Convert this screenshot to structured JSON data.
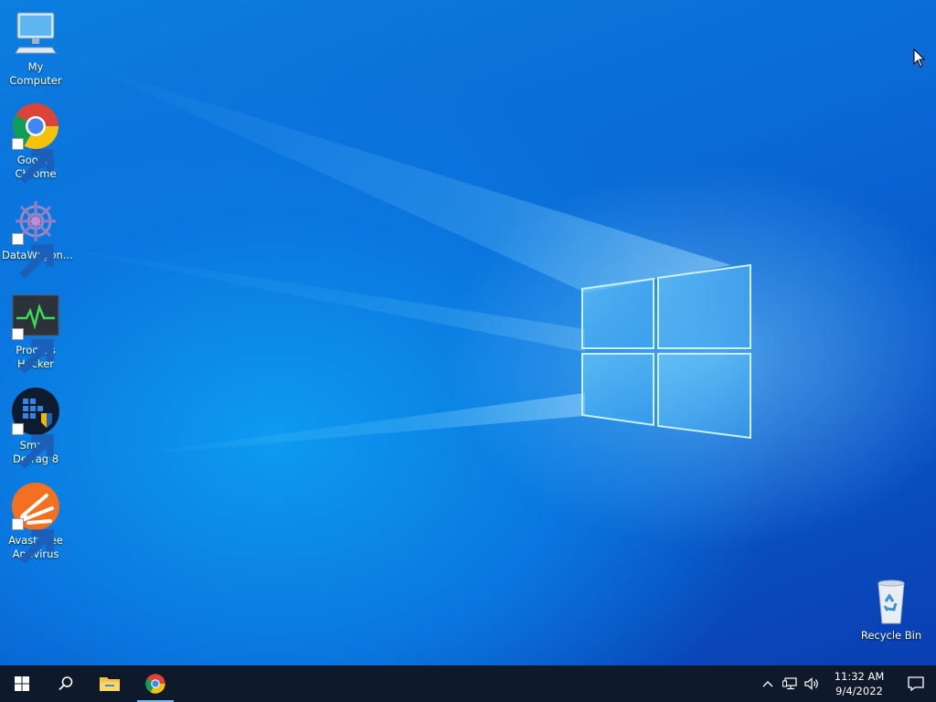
{
  "desktop": {
    "icons": [
      {
        "label": "My Computer",
        "icon": "computer-icon",
        "shortcut": false
      },
      {
        "label": "Google Chrome",
        "icon": "chrome-icon",
        "shortcut": true
      },
      {
        "label": "DataWagon...",
        "icon": "datawagon-icon",
        "shortcut": true
      },
      {
        "label": "Process Hacker",
        "icon": "process-hacker-icon",
        "shortcut": true
      },
      {
        "label": "Smart Defrag 8",
        "icon": "smart-defrag-icon",
        "shortcut": true
      },
      {
        "label": "Avast Free Antivirus",
        "icon": "avast-icon",
        "shortcut": true
      }
    ],
    "recycle_bin": {
      "label": "Recycle Bin",
      "icon": "recycle-bin-icon"
    }
  },
  "taskbar": {
    "start": {
      "icon": "windows-start-icon"
    },
    "search": {
      "icon": "search-icon"
    },
    "pinned": [
      {
        "name": "File Explorer",
        "icon": "folder-icon",
        "active": false
      },
      {
        "name": "Google Chrome",
        "icon": "chrome-icon",
        "active": true
      }
    ],
    "tray": {
      "icons": [
        "chevron-up-icon",
        "network-icon",
        "volume-icon"
      ],
      "time": "11:32 AM",
      "date": "9/4/2022",
      "notifications_icon": "notification-icon"
    }
  },
  "colors": {
    "taskbar_bg": "#0e1a2b",
    "wallpaper_blue": "#0a6fd8",
    "accent": "#7ab8f5"
  }
}
